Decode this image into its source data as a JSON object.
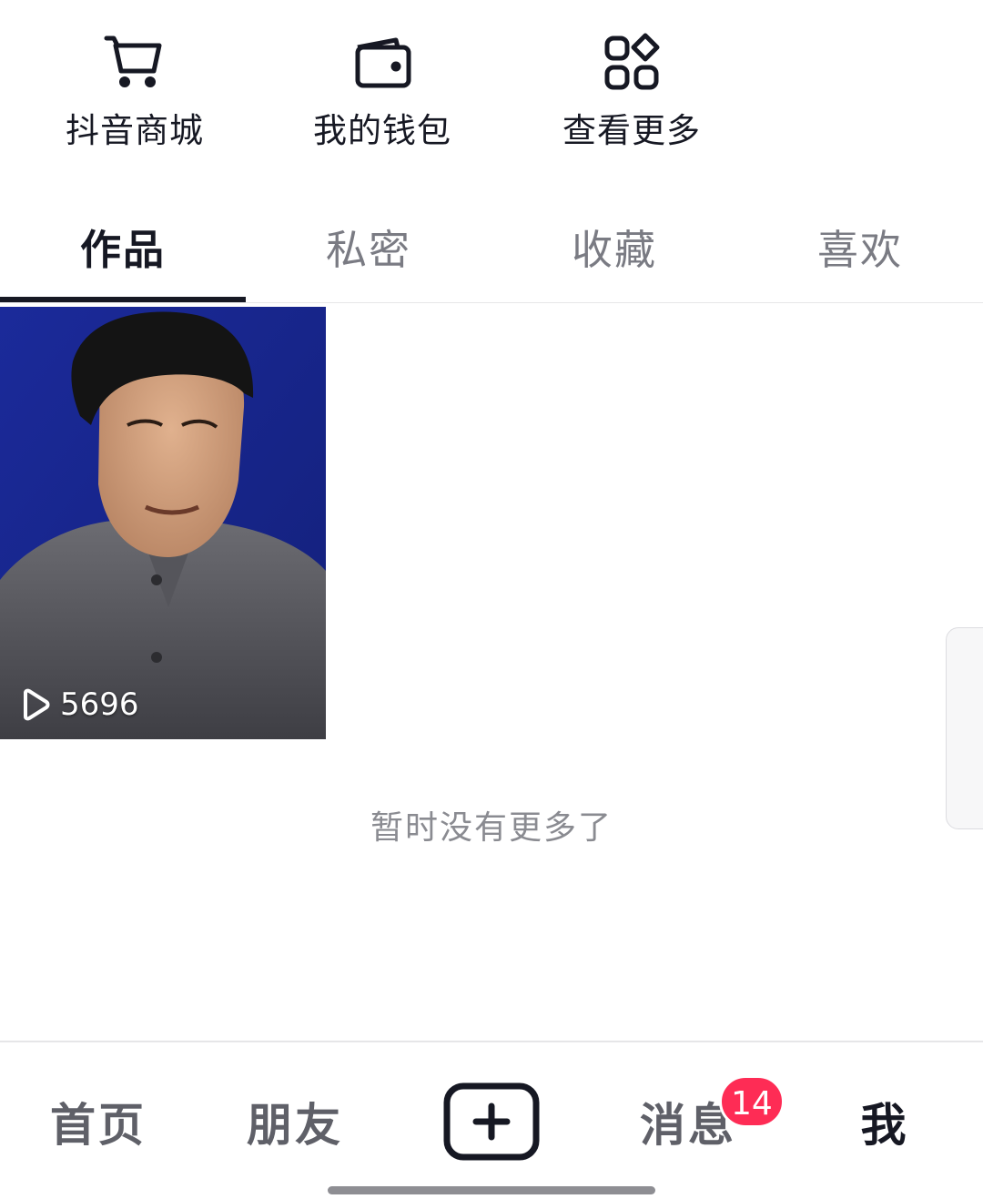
{
  "shortcuts": [
    {
      "label": "抖音商城",
      "icon": "shopping-cart-icon"
    },
    {
      "label": "我的钱包",
      "icon": "wallet-icon"
    },
    {
      "label": "查看更多",
      "icon": "grid-more-icon"
    }
  ],
  "tabs": [
    {
      "label": "作品",
      "active": true
    },
    {
      "label": "私密",
      "active": false
    },
    {
      "label": "收藏",
      "active": false
    },
    {
      "label": "喜欢",
      "active": false
    }
  ],
  "videos": [
    {
      "play_count": "5696",
      "icon": "play-outline-icon"
    }
  ],
  "end_message": "暂时没有更多了",
  "bottom_nav": {
    "home": "首页",
    "friends": "朋友",
    "create_icon": "plus-square-icon",
    "messages": "消息",
    "messages_badge": "14",
    "me": "我"
  },
  "colors": {
    "accent_underline": "#161823",
    "badge": "#fe2c55",
    "inactive_text": "#7a7b83"
  }
}
